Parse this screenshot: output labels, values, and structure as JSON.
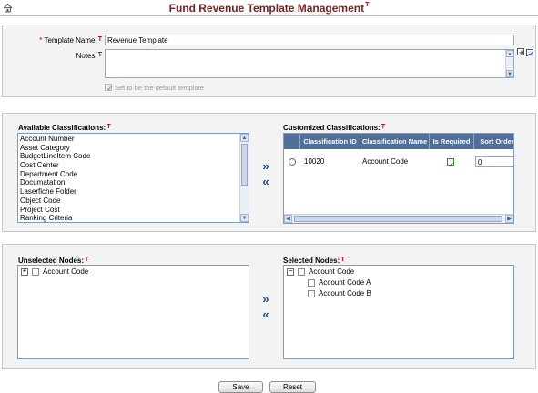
{
  "header": {
    "title": "Fund Revenue Template Management",
    "title_marker": "T"
  },
  "template_form": {
    "name_label": "Template Name:",
    "name_required_mark": "*",
    "name_marker": "T",
    "name_value": "Revenue Template",
    "notes_label": "Notes:",
    "notes_marker": "T",
    "notes_value": "",
    "default_label": "Set to be the default template",
    "default_checked": true,
    "default_disabled": true
  },
  "classifications": {
    "available_label": "Available Classifications:",
    "available_marker": "T",
    "available_items": [
      "Account Number",
      "Asset Category",
      "BudgetLineItem Code",
      "Cost Center",
      "Department Code",
      "Documatation",
      "Laserfiche Folder",
      "Object Code",
      "Project Cost",
      "Ranking Criteria"
    ],
    "add_arrow": "»",
    "remove_arrow": "«",
    "customized_label": "Customized Classifications:",
    "customized_marker": "T",
    "columns": [
      "Classification ID",
      "Classification Name",
      "Is Required",
      "Sort Order"
    ],
    "rows": [
      {
        "id": "10020",
        "name": "Account Code",
        "required": true,
        "sort_order": "0"
      }
    ]
  },
  "nodes": {
    "unselected_label": "Unselected Nodes:",
    "unselected_marker": "T",
    "unselected_tree": [
      {
        "label": "Account Code",
        "expander": "+"
      }
    ],
    "add_arrow": "»",
    "remove_arrow": "«",
    "selected_label": "Selected Nodes:",
    "selected_marker": "T",
    "selected_tree": {
      "label": "Account Code",
      "expander": "−",
      "children": [
        "Account Code A",
        "Account Code B"
      ]
    }
  },
  "actions": {
    "save_label": "Save",
    "reset_label": "Reset"
  },
  "colors": {
    "title": "#7a1f1f",
    "grid_header": "#4f6e9a",
    "required_marker": "#c00000"
  }
}
